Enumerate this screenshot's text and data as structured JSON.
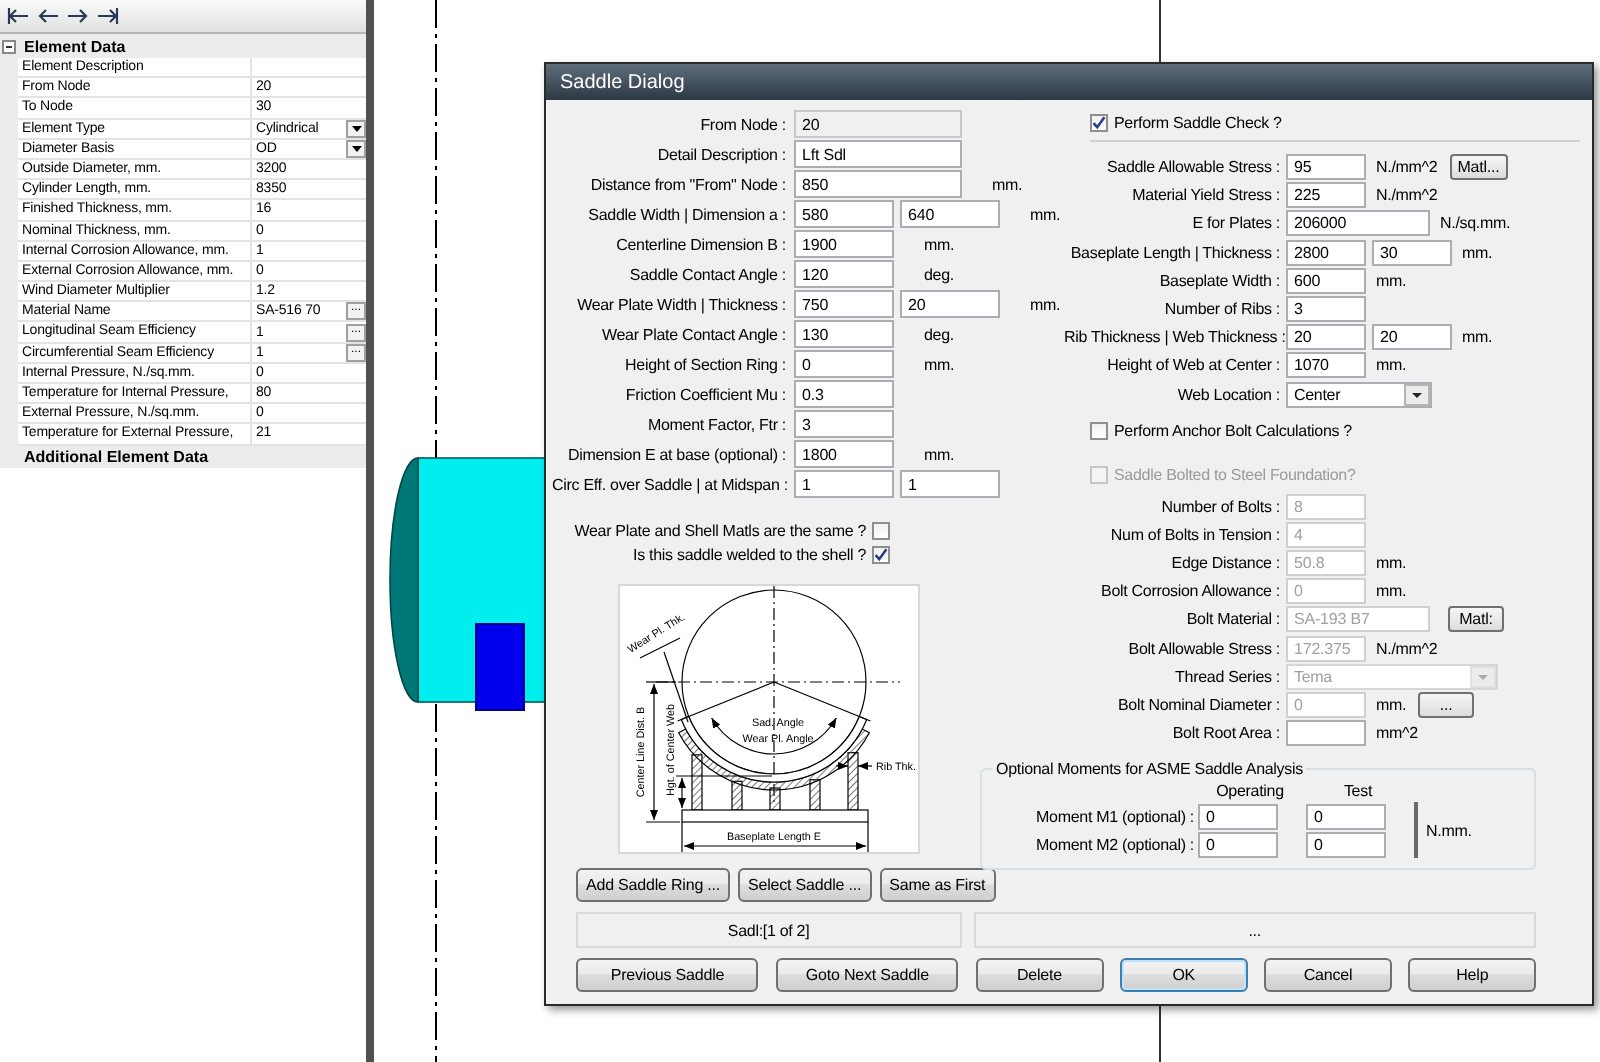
{
  "property_grid": {
    "section": {
      "title": "Element Data",
      "expanded": true,
      "rows": [
        {
          "label": "Element Description",
          "kind": "text"
        },
        {
          "label": "From Node",
          "value": "20",
          "kind": "text"
        },
        {
          "label": "To Node",
          "value": "30",
          "kind": "text"
        },
        {
          "label": "Element Type",
          "value": "Cylindrical",
          "kind": "dropdown"
        },
        {
          "label": "Diameter Basis",
          "value": "OD",
          "kind": "dropdown"
        },
        {
          "label": "Outside Diameter, mm.",
          "value": "3200",
          "kind": "text"
        },
        {
          "label": "Cylinder Length, mm.",
          "value": "8350",
          "kind": "text"
        },
        {
          "label": "Finished Thickness, mm.",
          "value": "16",
          "kind": "text"
        },
        {
          "label": "Nominal Thickness,  mm.",
          "value": "0",
          "kind": "text"
        },
        {
          "label": "Internal Corrosion Allowance,  mm.",
          "value": "1",
          "kind": "text"
        },
        {
          "label": "External Corrosion Allowance,  mm.",
          "value": "0",
          "kind": "text"
        },
        {
          "label": "Wind Diameter Multiplier",
          "value": "1.2",
          "kind": "text"
        },
        {
          "label": "Material Name",
          "value": "SA-516 70",
          "kind": "text",
          "button": "..."
        },
        {
          "label": "Longitudinal Seam Efficiency",
          "value": "1",
          "kind": "text",
          "button": "..."
        },
        {
          "label": "Circumferential Seam Efficiency",
          "value": "1",
          "kind": "text",
          "button": "..."
        },
        {
          "label": "Internal Pressure,  N./sq.mm.",
          "value": "0",
          "kind": "text"
        },
        {
          "label": "Temperature for Internal Pressure,",
          "value": "80",
          "kind": "text"
        },
        {
          "label": "External Pressure,  N./sq.mm.",
          "value": "0",
          "kind": "text"
        },
        {
          "label": "Temperature for External Pressure,",
          "value": "21",
          "kind": "text"
        }
      ]
    },
    "next_section": {
      "title": "Additional Element Data"
    }
  },
  "dialog": {
    "title": "Saddle Dialog",
    "left_fields": [
      {
        "label": "From Node :",
        "kind": "long-text",
        "read_only": true,
        "disabled": false,
        "values": [
          "20"
        ]
      },
      {
        "label": "Detail Description :",
        "kind": "long-text",
        "read_only": false,
        "disabled": false,
        "values": [
          "Lft Sdl"
        ]
      },
      {
        "label": "Distance from \"From\" Node :",
        "kind": "long-text",
        "read_only": false,
        "disabled": false,
        "values": [
          "850"
        ],
        "unit": "mm."
      },
      {
        "label": "Saddle Width | Dimension a :",
        "kind": "text",
        "read_only": false,
        "disabled": false,
        "values": [
          "580",
          "640"
        ],
        "unit": "mm."
      },
      {
        "label": "Centerline Dimension B :",
        "kind": "text",
        "read_only": false,
        "disabled": false,
        "values": [
          "1900"
        ],
        "unit": "mm."
      },
      {
        "label": "Saddle Contact Angle :",
        "kind": "text",
        "read_only": false,
        "disabled": false,
        "values": [
          "120"
        ],
        "unit": "deg."
      },
      {
        "label": "Wear Plate Width | Thickness :",
        "kind": "text",
        "read_only": false,
        "disabled": false,
        "values": [
          "750",
          "20"
        ],
        "unit": "mm."
      },
      {
        "label": "Wear Plate Contact Angle :",
        "kind": "text",
        "read_only": false,
        "disabled": false,
        "values": [
          "130"
        ],
        "unit": "deg."
      },
      {
        "label": "Height of Section Ring :",
        "kind": "text",
        "read_only": false,
        "disabled": false,
        "values": [
          "0"
        ],
        "unit": "mm."
      },
      {
        "label": "Friction Coefficient Mu :",
        "kind": "text",
        "read_only": false,
        "disabled": false,
        "values": [
          "0.3"
        ]
      },
      {
        "label": "Moment Factor, Ftr :",
        "kind": "text",
        "read_only": false,
        "disabled": false,
        "values": [
          "3"
        ]
      },
      {
        "label": "Dimension E at base (optional) :",
        "kind": "text",
        "read_only": false,
        "disabled": false,
        "values": [
          "1800"
        ],
        "unit": "mm."
      },
      {
        "label": "Circ Eff. over Saddle | at Midspan :",
        "kind": "text",
        "read_only": false,
        "disabled": false,
        "values": [
          "1",
          "1"
        ]
      }
    ],
    "left_checks": [
      {
        "label": "Wear Plate and Shell Matls are the same ?",
        "checked": false
      },
      {
        "label": "Is this saddle welded to the shell ?",
        "checked": true
      }
    ],
    "diagram": {
      "labels": [
        {
          "kind": "wear-thk",
          "text": "Wear Pl. Thk."
        },
        {
          "kind": "centerline",
          "text": "Center Line Dist. B"
        },
        {
          "kind": "web-height",
          "text": "Hgt. of Center Web"
        },
        {
          "kind": "sad-angle",
          "text": "Sad. Angle"
        },
        {
          "kind": "wear-angle",
          "text": "Wear Pl. Angle"
        },
        {
          "kind": "rib-thk",
          "text": "Rib Thk."
        },
        {
          "kind": "baseplate",
          "text": "Baseplate Length E"
        }
      ]
    },
    "left_buttons": [
      "Add Saddle Ring ...",
      "Select Saddle ...",
      "Same as First"
    ],
    "saddle_check": {
      "label": "Perform Saddle Check ?",
      "checked": true
    },
    "saddle_fields": [
      {
        "label": "Saddle Allowable Stress :",
        "kind": "text",
        "read_only": false,
        "disabled": false,
        "values": [
          "95"
        ],
        "unit": "N./mm^2",
        "button": "Matl..."
      },
      {
        "label": "Material Yield Stress :",
        "kind": "text",
        "read_only": false,
        "disabled": false,
        "values": [
          "225"
        ],
        "unit": "N./mm^2"
      },
      {
        "label": "E for Plates :",
        "kind": "long-text",
        "read_only": false,
        "disabled": false,
        "values": [
          "206000"
        ],
        "unit": "N./sq.mm."
      },
      {
        "label": "Baseplate Length | Thickness :",
        "kind": "text",
        "read_only": false,
        "disabled": false,
        "values": [
          "2800",
          "30"
        ],
        "unit": "mm."
      },
      {
        "label": "Baseplate Width :",
        "kind": "text",
        "read_only": false,
        "disabled": false,
        "values": [
          "600"
        ],
        "unit": "mm."
      },
      {
        "label": "Number of Ribs :",
        "kind": "text",
        "read_only": false,
        "disabled": false,
        "values": [
          "3"
        ]
      },
      {
        "label": "Rib Thickness | Web Thickness :",
        "kind": "text",
        "read_only": false,
        "disabled": false,
        "values": [
          "20",
          "20"
        ],
        "unit": "mm."
      },
      {
        "label": "Height of Web at Center :",
        "kind": "text",
        "read_only": false,
        "disabled": false,
        "values": [
          "1070"
        ],
        "unit": "mm."
      },
      {
        "label": "Web Location :",
        "kind": "dropdown",
        "read_only": false,
        "disabled": false,
        "values": [
          "Center"
        ]
      }
    ],
    "anchor_check": {
      "label": "Perform Anchor Bolt Calculations ?",
      "checked": false
    },
    "bolted_check": {
      "label": "Saddle Bolted to Steel Foundation?",
      "checked": false,
      "disabled": true
    },
    "bolt_fields": [
      {
        "label": "Number of Bolts :",
        "kind": "text",
        "read_only": false,
        "disabled": true,
        "values": [
          "8"
        ]
      },
      {
        "label": "Num of Bolts in Tension :",
        "kind": "text",
        "read_only": false,
        "disabled": true,
        "values": [
          "4"
        ]
      },
      {
        "label": "Edge Distance :",
        "kind": "text",
        "read_only": false,
        "disabled": true,
        "values": [
          "50.8"
        ],
        "unit": "mm."
      },
      {
        "label": "Bolt Corrosion Allowance :",
        "kind": "text",
        "read_only": false,
        "disabled": true,
        "values": [
          "0"
        ],
        "unit": "mm."
      },
      {
        "label": "Bolt Material :",
        "kind": "long-text",
        "read_only": false,
        "disabled": true,
        "values": [
          "SA-193 B7"
        ],
        "button": "Matl:"
      },
      {
        "label": "Bolt Allowable Stress :",
        "kind": "text",
        "read_only": false,
        "disabled": true,
        "values": [
          "172.375"
        ],
        "unit": "N./mm^2"
      },
      {
        "label": "Thread Series :",
        "kind": "long-dropdown",
        "read_only": false,
        "disabled": true,
        "values": [
          "Tema"
        ]
      },
      {
        "label": "Bolt Nominal Diameter :",
        "kind": "text",
        "read_only": false,
        "disabled": true,
        "values": [
          "0"
        ],
        "unit": "mm.",
        "button": "..."
      },
      {
        "label": "Bolt Root Area :",
        "kind": "blank",
        "read_only": false,
        "disabled": false,
        "unit": "mm^2"
      }
    ],
    "moments": {
      "title": "Optional Moments for ASME Saddle Analysis",
      "columns": [
        "Operating",
        "Test"
      ],
      "rows": [
        {
          "label": "Moment M1 (optional) :",
          "values": [
            "0",
            "0"
          ]
        },
        {
          "label": "Moment M2 (optional) :",
          "values": [
            "0",
            "0"
          ]
        }
      ],
      "unit": "N.mm."
    },
    "status": [
      "Sadl:[1 of 2]",
      "..."
    ],
    "buttons": [
      {
        "label": "Previous Saddle",
        "default": false
      },
      {
        "label": "Goto Next Saddle",
        "default": false
      },
      {
        "label": "Delete",
        "default": false
      },
      {
        "label": "OK",
        "default": true
      },
      {
        "label": "Cancel",
        "default": false
      },
      {
        "label": "Help",
        "default": false
      }
    ]
  }
}
